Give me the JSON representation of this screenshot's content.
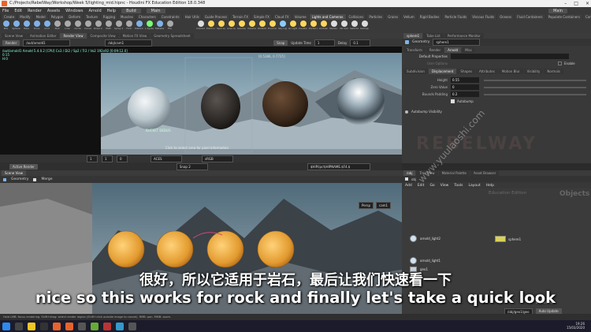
{
  "window": {
    "title": "C:/Projects/RebelWay/Workshop/Week 5/lighting_mid.hipnc - Houdini FX Education Edition 18.0.348"
  },
  "menu": {
    "items": [
      "File",
      "Edit",
      "Render",
      "Assets",
      "Windows",
      "Arnold",
      "Help"
    ],
    "desktop": "Build",
    "main": "Main"
  },
  "shelf_tabs": [
    "Create",
    "Modify",
    "Model",
    "Polygon",
    "Deform",
    "Texture",
    "Rigging",
    "Muscles",
    "Characters",
    "Constraints",
    "Hair Utils",
    "Guide Process",
    "Terrain FX",
    "Simple FX",
    "Cloud FX",
    "Volume",
    "Lights and Cameras",
    "Collisions",
    "Particles",
    "Grains",
    "Vellum",
    "Rigid Bodies",
    "Particle Fluids",
    "Viscous Fluids",
    "Oceans",
    "Fluid Containers",
    "Populate Containers",
    "Container Tools",
    "Pyro FX",
    "Sparse Pyro FX",
    "FEM",
    "Wires",
    "Crowds",
    "Drive Simulation"
  ],
  "shelf_tools": [
    {
      "label": "Box",
      "color": "#7fb2e8"
    },
    {
      "label": "Sphere",
      "color": "#7fb2e8"
    },
    {
      "label": "Tube",
      "color": "#7fb2e8"
    },
    {
      "label": "Torus",
      "color": "#7fb2e8"
    },
    {
      "label": "Grid",
      "color": "#7fb2e8"
    },
    {
      "label": "Null",
      "color": "#aaa"
    },
    {
      "label": "Line",
      "color": "#aaa"
    },
    {
      "label": "Circle",
      "color": "#aaa"
    },
    {
      "label": "Curve",
      "color": "#aaa"
    },
    {
      "label": "Draw Curve",
      "color": "#aaa"
    },
    {
      "label": "Path",
      "color": "#aaa"
    },
    {
      "label": "Spray Paint",
      "color": "#aaa"
    },
    {
      "label": "Font",
      "color": "#aaa"
    },
    {
      "label": "Platonic Solids",
      "color": "#7fb2e8"
    },
    {
      "label": "L-System",
      "color": "#7f7"
    },
    {
      "label": "Metaball",
      "color": "#7fb2e8"
    },
    {
      "label": "File",
      "color": "#aaa"
    },
    {
      "label": "Camera",
      "color": "#ddd"
    },
    {
      "label": "Point Light",
      "color": "#ffd75a"
    },
    {
      "label": "Spot Light",
      "color": "#ffd75a"
    },
    {
      "label": "Area Light",
      "color": "#ffd75a"
    },
    {
      "label": "Geometry Light",
      "color": "#ffd75a"
    },
    {
      "label": "Volume Light",
      "color": "#ffd75a"
    },
    {
      "label": "Distant Light",
      "color": "#ffd75a"
    },
    {
      "label": "Environment Light",
      "color": "#ffd75a"
    },
    {
      "label": "Sky Light",
      "color": "#8cf"
    },
    {
      "label": "GI Light",
      "color": "#ffd75a"
    },
    {
      "label": "Caustic Light",
      "color": "#ffd75a"
    },
    {
      "label": "Portal Light",
      "color": "#ffd75a"
    },
    {
      "label": "Ambient Light",
      "color": "#ffd75a"
    },
    {
      "label": "Stereo Camera",
      "color": "#ddd"
    },
    {
      "label": "VR Camera",
      "color": "#ddd"
    },
    {
      "label": "Switcher",
      "color": "#ddd"
    },
    {
      "label": "Gamepad Camera",
      "color": "#ddd"
    }
  ],
  "top_panes": {
    "tabs": [
      "Scene View",
      "Animation Editor",
      "Render View",
      "Composite View",
      "Motion FX View",
      "Geometry Spreadsheet"
    ],
    "active": "Render View"
  },
  "render_toolbar": {
    "render_btn": "Render",
    "rop": "/out/arnold1",
    "camera": "/obj/cam1",
    "snap_btn": "Snap",
    "update_label": "Update Time",
    "update_value": "1",
    "delay_label": "Delay",
    "delay_value": "0.1"
  },
  "render_info": {
    "line1": "/out/arnold1  Arnold 5.4.0.2 [CPU] Cx3 / Di2 / Sp2 / Tr2 / Vo2  192x92  [0:09:12.0]",
    "line2": "0:15",
    "line3": "H:0"
  },
  "render_overlay_text": "Click to select area for pixel information",
  "render_bottom": {
    "frame_a": "1",
    "frame_b": "1",
    "frame_c": "0",
    "colorspace": "ACES",
    "display": "sRGB",
    "snap": "Snap 2"
  },
  "active_render": {
    "label": "Active Render",
    "path": "$HIP/ipr/$HIPNAME.$F4.$"
  },
  "param_pane": {
    "tabs": [
      "sphere1",
      "Tube List",
      "Performance Monitor"
    ],
    "node_type": "Geometry",
    "node_name": "sphere1",
    "section_tabs": [
      "Transform",
      "Render",
      "Arnold",
      "Misc"
    ],
    "default_props": "Default Properties",
    "use_options": "User Options",
    "enable": "Enable",
    "sub_tabs": [
      "Subdivision",
      "Displacement",
      "Shapes",
      "Attributes",
      "Motion Blur",
      "Visibility",
      "Normals"
    ],
    "params": [
      {
        "label": "Height",
        "value": "0.55"
      },
      {
        "label": "Zero Value",
        "value": "0"
      },
      {
        "label": "Bounds Padding",
        "value": "0.2"
      }
    ],
    "autobump": "Autobump",
    "autobump_vis": "Autobump Visibility"
  },
  "lower_bar": {
    "tabs": [
      "Scene View",
      "Geometry",
      "Merge"
    ],
    "display": "Persp",
    "cam": "cam1"
  },
  "network": {
    "tabs": [
      "/obj",
      "Tree View",
      "Material Palette",
      "Asset Browser"
    ],
    "path": "obj",
    "menu": [
      "Add",
      "Edit",
      "Go",
      "View",
      "Tools",
      "Layout",
      "Help"
    ],
    "edition": "Education Edition",
    "objects": "Objects",
    "nodes": [
      {
        "label": "arnold_light2"
      },
      {
        "label": "arnold_light1"
      },
      {
        "label": "sphere1"
      },
      {
        "label": "geo1"
      }
    ]
  },
  "bottom_right": {
    "path": "/obj/geo1/geo",
    "auto_update": "Auto Update",
    "channels": "8 channels"
  },
  "status": "Hold LMB: focus rendering. Shift+drag: select render region (Shift+click outside image to cancel). RMB: pan. MMB: zoom.",
  "clock": {
    "time": "19:26",
    "date": "15/03/2020"
  },
  "subtitles": {
    "zh": "很好，所以它适用于岩石，最后让我们快速看一下",
    "en": "nice so this works for rock and finally let's take a quick look"
  },
  "watermark": "www.yuulaoshi.com"
}
